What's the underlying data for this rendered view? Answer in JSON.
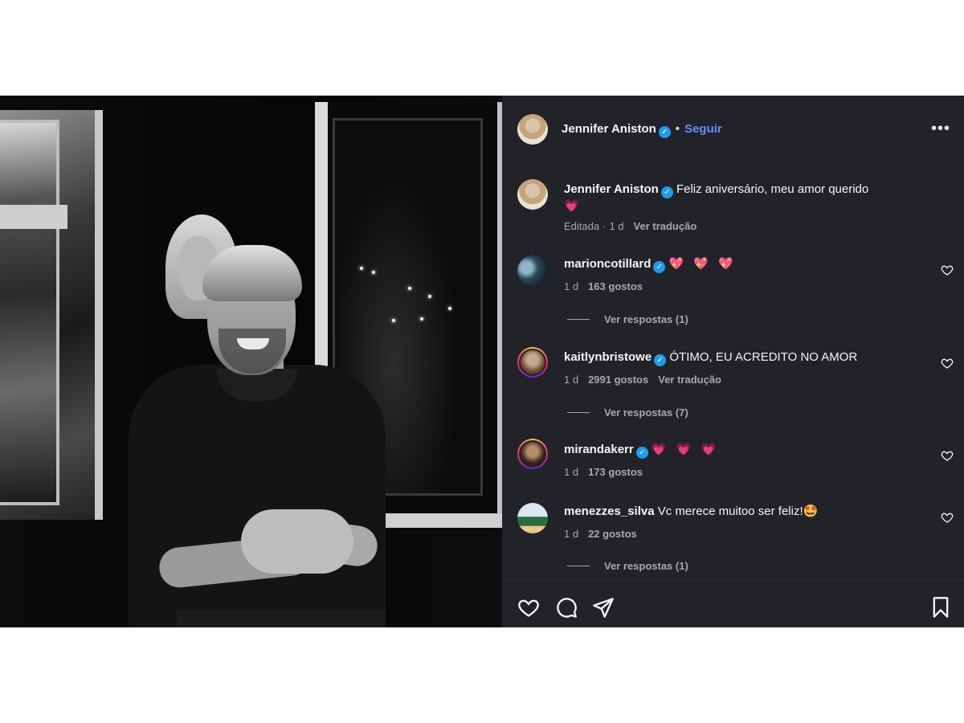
{
  "post": {
    "author": "Jennifer Aniston",
    "follow_label": "Seguir",
    "more_label": "•••",
    "caption": {
      "author": "Jennifer Aniston",
      "text": "Feliz aniversário, meu amor querido",
      "emoji": "💗",
      "edited": "Editada",
      "time": "1 d",
      "translate": "Ver tradução"
    }
  },
  "comments": [
    {
      "username": "marioncotillard",
      "text": "💖 💖 💖",
      "time": "1 d",
      "likes": "163 gostos",
      "replies": "Ver respostas (1)"
    },
    {
      "username": "kaitlynbristowe",
      "text": "ÓTIMO, EU ACREDITO NO AMOR",
      "time": "1 d",
      "likes": "2991 gostos",
      "translate": "Ver tradução",
      "replies": "Ver respostas (7)"
    },
    {
      "username": "mirandakerr",
      "text": "💗 💗 💗",
      "time": "1 d",
      "likes": "173 gostos"
    },
    {
      "username": "menezzes_silva",
      "text": "Vc merece muitoo ser feliz!",
      "emoji": "🤩",
      "time": "1 d",
      "likes": "22 gostos",
      "replies": "Ver respostas (1)"
    }
  ],
  "icons": {
    "verified": "✓",
    "like": "heart-icon",
    "comment": "comment-icon",
    "share": "share-icon",
    "save": "bookmark-icon"
  },
  "colors": {
    "panel_bg": "#212328",
    "follow": "#6b8bff",
    "verified": "#1d9bf0",
    "muted": "#a8a8a8"
  }
}
